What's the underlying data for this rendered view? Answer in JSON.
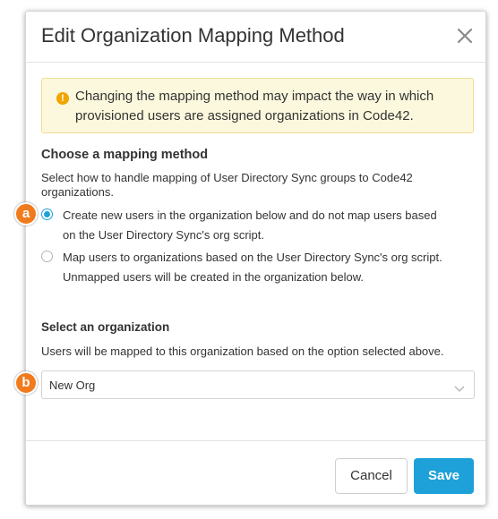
{
  "dialog": {
    "title": "Edit Organization Mapping Method",
    "close_icon": "close-icon"
  },
  "warning": {
    "icon": "warning-icon",
    "text": "Changing the mapping method may impact the way in which provisioned users are assigned organizations in Code42."
  },
  "mapping": {
    "title": "Choose a mapping method",
    "description": "Select how to handle mapping of User Directory Sync groups to Code42 organizations.",
    "options": [
      {
        "label": "Create new users in the organization below and do not map users based on the User Directory Sync's org script.",
        "checked": true
      },
      {
        "label": "Map users to organizations based on the User Directory Sync's org script. Unmapped users will be created in the organization below.",
        "checked": false
      }
    ]
  },
  "organization": {
    "title": "Select an organization",
    "description": "Users will be mapped to this organization based on the option selected above.",
    "selected": "New Org"
  },
  "buttons": {
    "cancel": "Cancel",
    "save": "Save"
  },
  "callouts": {
    "a": "a",
    "b": "b"
  },
  "colors": {
    "accent": "#1da1d8",
    "callout": "#f07b1e",
    "warning_bg": "#fcf8dd",
    "warning_icon": "#f0a500"
  }
}
